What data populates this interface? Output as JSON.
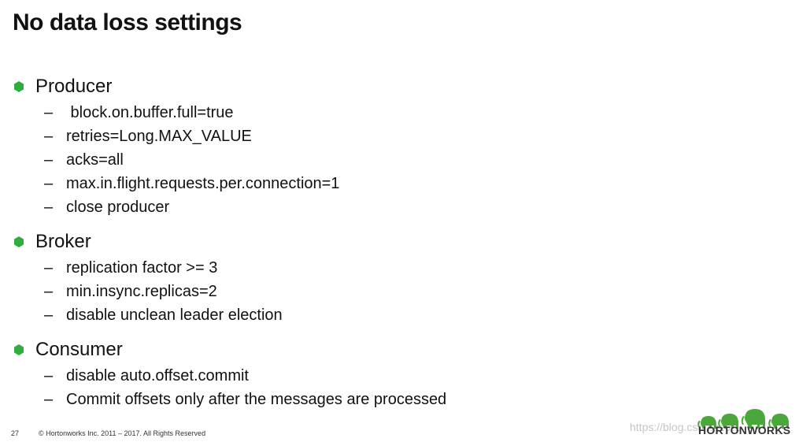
{
  "title": "No data loss settings",
  "accent_color": "#2eae3f",
  "sections": [
    {
      "title": "Producer",
      "items": [
        " block.on.buffer.full=true",
        "retries=Long.MAX_VALUE",
        "acks=all",
        "max.in.flight.requests.per.connection=1",
        "close producer"
      ]
    },
    {
      "title": "Broker",
      "items": [
        "replication factor >= 3",
        "min.insync.replicas=2",
        "disable unclean leader election"
      ]
    },
    {
      "title": "Consumer",
      "items": [
        "disable auto.offset.commit",
        "Commit offsets only after the messages are processed"
      ]
    }
  ],
  "dash": "–",
  "footer": {
    "page": "27",
    "copyright": "© Hortonworks Inc. 2011 – 2017. All Rights Reserved"
  },
  "logo": {
    "text": "HORTONWORKS",
    "icon": "elephant-herd-icon"
  },
  "watermark": "https://blog.csdn.net/..."
}
